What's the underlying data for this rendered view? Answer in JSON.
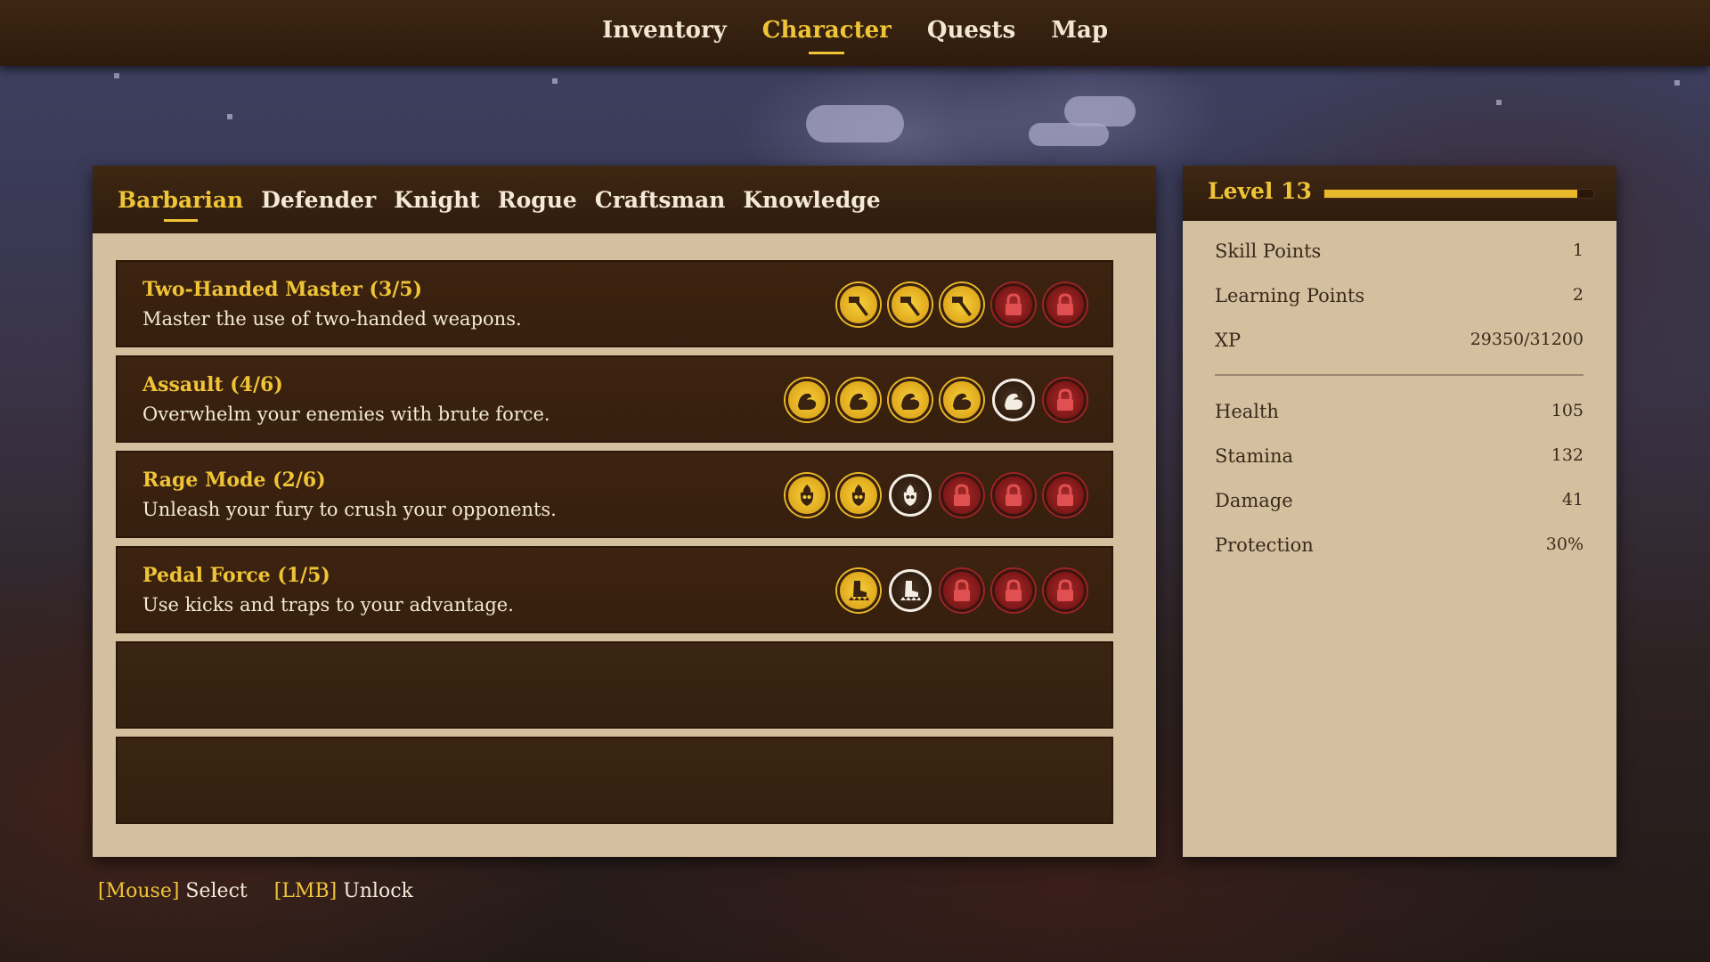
{
  "top_nav": {
    "tabs": [
      {
        "label": "Inventory"
      },
      {
        "label": "Character"
      },
      {
        "label": "Quests"
      },
      {
        "label": "Map"
      }
    ],
    "active": "Character"
  },
  "class_tabs": {
    "tabs": [
      {
        "label": "Barbarian"
      },
      {
        "label": "Defender"
      },
      {
        "label": "Knight"
      },
      {
        "label": "Rogue"
      },
      {
        "label": "Craftsman"
      },
      {
        "label": "Knowledge"
      }
    ],
    "active": "Barbarian"
  },
  "skills": [
    {
      "title": "Two-Handed Master (3/5)",
      "description": "Master the use of two-handed weapons.",
      "icon": "hammer-icon",
      "pips": [
        "unlocked",
        "unlocked",
        "unlocked",
        "locked",
        "locked"
      ]
    },
    {
      "title": "Assault (4/6)",
      "description": "Overwhelm your enemies with brute force.",
      "icon": "flexed-arm-icon",
      "pips": [
        "unlocked",
        "unlocked",
        "unlocked",
        "unlocked",
        "available",
        "locked"
      ]
    },
    {
      "title": "Rage Mode (2/6)",
      "description": "Unleash your fury to crush your opponents.",
      "icon": "flaming-skull-icon",
      "pips": [
        "unlocked",
        "unlocked",
        "available",
        "locked",
        "locked",
        "locked"
      ]
    },
    {
      "title": "Pedal Force (1/5)",
      "description": "Use kicks and traps to your advantage.",
      "icon": "boot-trap-icon",
      "pips": [
        "unlocked",
        "available",
        "locked",
        "locked",
        "locked"
      ]
    }
  ],
  "character": {
    "level_label": "Level 13",
    "xp_progress": 0.94,
    "stats_primary": [
      {
        "label": "Skill Points",
        "value": "1"
      },
      {
        "label": "Learning Points",
        "value": "2"
      },
      {
        "label": "XP",
        "value": "29350/31200"
      }
    ],
    "stats_secondary": [
      {
        "label": "Health",
        "value": "105"
      },
      {
        "label": "Stamina",
        "value": "132"
      },
      {
        "label": "Damage",
        "value": "41"
      },
      {
        "label": "Protection",
        "value": "30%"
      }
    ]
  },
  "controls": [
    {
      "key": "[Mouse]",
      "action": "Select"
    },
    {
      "key": "[LMB]",
      "action": "Unlock"
    }
  ],
  "colors": {
    "accent": "#f0c437",
    "locked": "#9c2424",
    "panel": "#d4bf9e",
    "dark": "#3d2310"
  }
}
